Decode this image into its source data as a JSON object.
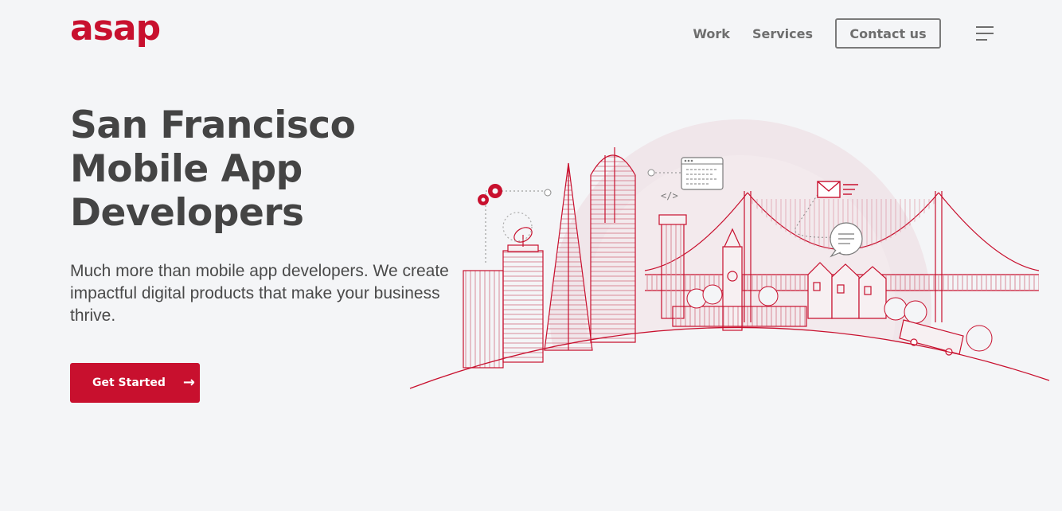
{
  "brand": {
    "logo_text": "asap",
    "color": "#c8102e"
  },
  "nav": {
    "links": [
      "Work",
      "Services"
    ],
    "contact_label": "Contact us",
    "menu_icon": "hamburger-menu-icon"
  },
  "hero": {
    "title_lines": [
      "San Francisco",
      "Mobile App",
      "Developers"
    ],
    "subtitle": "Much more than mobile app developers. We create impactful digital products that make your business thrive.",
    "cta_label": "Get Started",
    "cta_icon": "arrow-right-icon"
  },
  "illustration": {
    "code_tag": "</>",
    "icons": [
      "gears-icon",
      "satellite-dish-icon",
      "code-window-icon",
      "envelope-icon",
      "chat-bubble-icon",
      "cable-car-icon"
    ]
  }
}
